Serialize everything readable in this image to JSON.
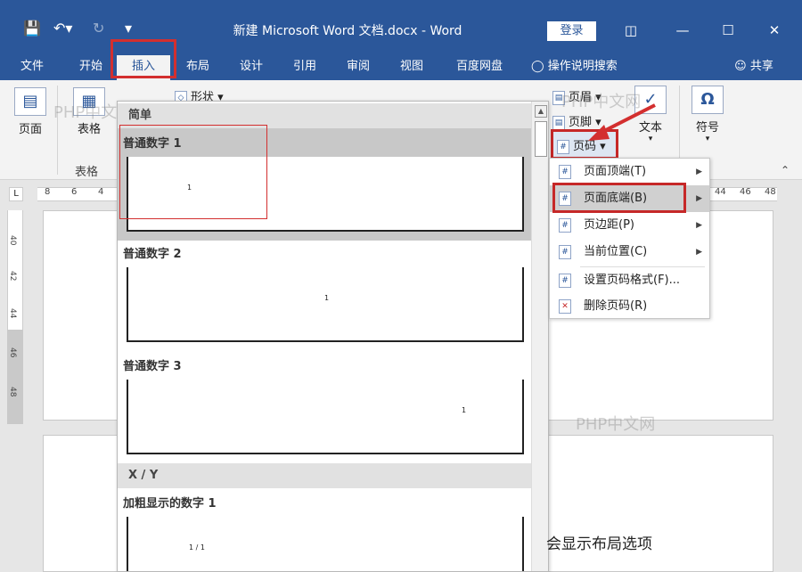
{
  "titlebar": {
    "title": "新建 Microsoft Word 文档.docx  -  Word",
    "login_label": "登录",
    "icons": [
      "save-icon",
      "undo-icon",
      "redo-icon",
      "customize-icon"
    ]
  },
  "tabs": [
    "文件",
    "开始",
    "插入",
    "布局",
    "设计",
    "引用",
    "审阅",
    "视图",
    "百度网盘"
  ],
  "tab_active": "插入",
  "help_search": "操作说明搜索",
  "share_label": "共享",
  "ribbon": {
    "page_label": "页面",
    "table_label": "表格",
    "table_group_label": "表格",
    "shapes_label": "形状",
    "header_label": "页眉",
    "footer_label": "页脚",
    "page_number_label": "页码",
    "text_label": "文本",
    "symbol_label": "符号"
  },
  "ruler_numbers": [
    "8",
    "6",
    "4",
    "44",
    "46",
    "48"
  ],
  "vruler_numbers": [
    "40",
    "42",
    "44",
    "46",
    "48"
  ],
  "gallery": {
    "section_simple": "简单",
    "item1": "普通数字 1",
    "item2": "普通数字 2",
    "item3": "普通数字 3",
    "section_xy": "X / Y",
    "item4": "加粗显示的数字 1",
    "num1": "1",
    "num2": "1",
    "num3": "1",
    "num4": "1 / 1"
  },
  "context_menu": {
    "items": [
      {
        "label": "页面顶端(T)",
        "has_submenu": true
      },
      {
        "label": "页面底端(B)",
        "has_submenu": true
      },
      {
        "label": "页边距(P)",
        "has_submenu": true
      },
      {
        "label": "当前位置(C)",
        "has_submenu": true
      },
      {
        "label": "设置页码格式(F)...",
        "has_submenu": false
      },
      {
        "label": "删除页码(R)",
        "has_submenu": false
      }
    ]
  },
  "watermark": "PHP中文网",
  "bottom_text": "会显示布局选项",
  "colors": {
    "word_blue": "#2b579a",
    "highlight_red": "#c62828"
  }
}
